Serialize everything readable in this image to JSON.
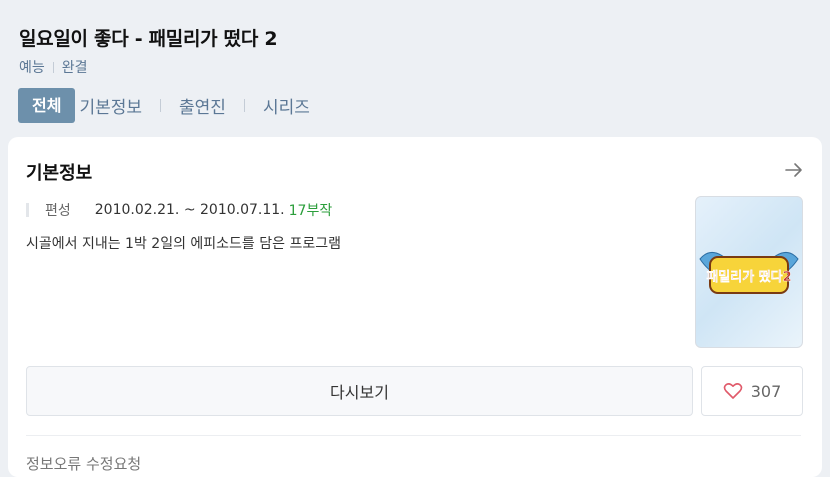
{
  "header": {
    "title": "일요일이 좋다 - 패밀리가 떴다 2",
    "genre": "예능",
    "status": "완결"
  },
  "tabs": [
    {
      "label": "전체",
      "active": true
    },
    {
      "label": "기본정보",
      "active": false
    },
    {
      "label": "출연진",
      "active": false
    },
    {
      "label": "시리즈",
      "active": false
    }
  ],
  "basic_info": {
    "section_title": "기본정보",
    "schedule_label": "편성",
    "date_range": "2010.02.21. ~ 2010.07.11.",
    "episodes": "17부작",
    "description": "시골에서 지내는 1박 2일의 에피소드를 담은 프로그램",
    "poster_logo": "패밀리가 떴다2",
    "rewatch_label": "다시보기",
    "like_count": "307",
    "edit_request_label": "정보오류 수정요청"
  },
  "colors": {
    "accent": "#6d90ab",
    "link": "#5b7795",
    "episodes": "#2b9e3b",
    "heart": "#e05a6a"
  },
  "icons": [
    "arrow-right-icon",
    "heart-icon"
  ]
}
